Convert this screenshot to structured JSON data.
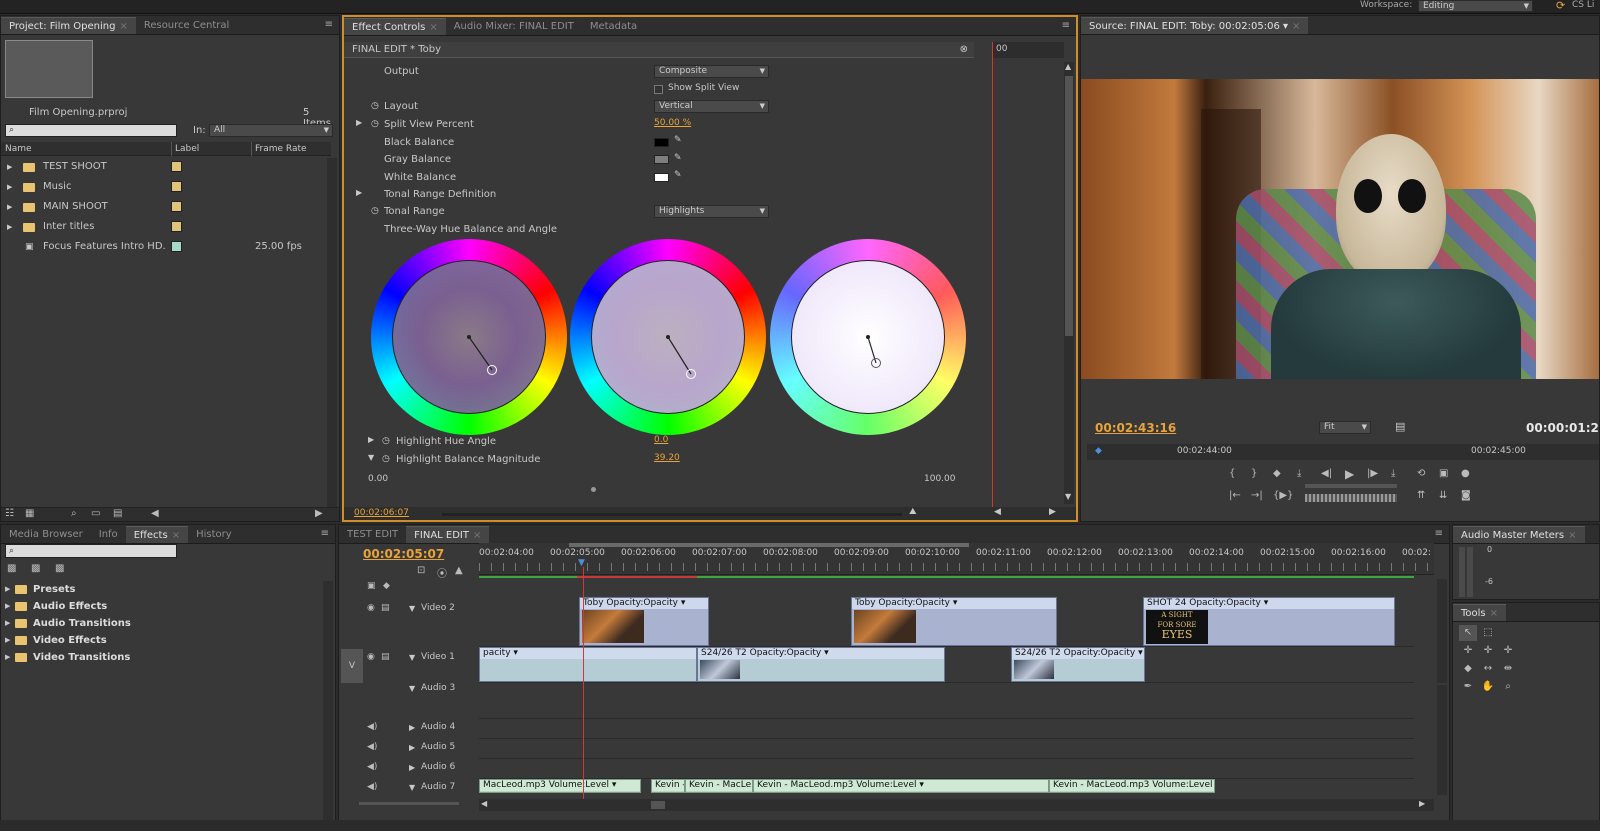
{
  "topbar": {
    "workspace_label": "Workspace:",
    "workspace_value": "Editing",
    "right_label": "CS Li"
  },
  "project_panel": {
    "tabs": [
      "Project: Film Opening",
      "Resource Central"
    ],
    "project_file": "Film Opening.prproj",
    "item_count": "5 Items",
    "in_label": "In:",
    "in_value": "All",
    "columns": [
      "Name",
      "Label",
      "Frame Rate"
    ],
    "items": [
      {
        "name": "TEST SHOOT",
        "label_color": "#e0c47a",
        "frame_rate": ""
      },
      {
        "name": "Music",
        "label_color": "#e0c47a",
        "frame_rate": ""
      },
      {
        "name": "MAIN SHOOT",
        "label_color": "#e0c47a",
        "frame_rate": ""
      },
      {
        "name": "Inter titles",
        "label_color": "#e0c47a",
        "frame_rate": ""
      },
      {
        "name": "Focus Features Intro HD.",
        "label_color": "#a8d8c8",
        "frame_rate": "25.00 fps"
      }
    ]
  },
  "effect_controls": {
    "tabs": [
      "Effect Controls",
      "Audio Mixer: FINAL EDIT",
      "Metadata"
    ],
    "clip_title": "FINAL EDIT * Toby",
    "mini_time": "00",
    "params": {
      "output_label": "Output",
      "output_value": "Composite",
      "show_split_view": "Show Split View",
      "layout_label": "Layout",
      "layout_value": "Vertical",
      "split_label": "Split View Percent",
      "split_value": "50.00 %",
      "black_balance": "Black Balance",
      "gray_balance": "Gray Balance",
      "white_balance": "White Balance",
      "tonal_def": "Tonal Range Definition",
      "tonal_label": "Tonal Range",
      "tonal_value": "Highlights",
      "three_way": "Three-Way Hue Balance and Angle",
      "hue_angle_label": "Highlight Hue Angle",
      "hue_angle_value": "0.0",
      "magnitude_label": "Highlight Balance Magnitude",
      "magnitude_value": "39.20",
      "slider_min": "0.00",
      "slider_max": "100.00"
    },
    "timecode": "00:02:06:07"
  },
  "source_monitor": {
    "tab": "Source: FINAL EDIT: Toby: 00:02:05:06",
    "timecode_left": "00:02:43:16",
    "fit_value": "Fit",
    "timecode_right": "00:00:01:2",
    "ruler": [
      "00:02:44:00",
      "00:02:45:00"
    ]
  },
  "effects_panel": {
    "tabs": [
      "Media Browser",
      "Info",
      "Effects",
      "History"
    ],
    "folders": [
      "Presets",
      "Audio Effects",
      "Audio Transitions",
      "Video Effects",
      "Video Transitions"
    ]
  },
  "timeline": {
    "tabs": [
      "TEST EDIT",
      "FINAL EDIT"
    ],
    "timecode": "00:02:05:07",
    "ruler": [
      "00:02:04:00",
      "00:02:05:00",
      "00:02:06:00",
      "00:02:07:00",
      "00:02:08:00",
      "00:02:09:00",
      "00:02:10:00",
      "00:02:11:00",
      "00:02:12:00",
      "00:02:13:00",
      "00:02:14:00",
      "00:02:15:00",
      "00:02:16:00",
      "00:02:"
    ],
    "tracks": {
      "video2": "Video 2",
      "video1": "Video 1",
      "audio3": "Audio 3",
      "audio4": "Audio 4",
      "audio5": "Audio 5",
      "audio6": "Audio 6",
      "audio7": "Audio 7"
    },
    "video2_clips": [
      {
        "name": "Toby",
        "fx": "Opacity:Opacity"
      },
      {
        "name": "Toby",
        "fx": "Opacity:Opacity"
      },
      {
        "name": "SHOT 24",
        "fx": "Opacity:Opacity"
      }
    ],
    "video1_clips": [
      {
        "name": "",
        "fx": "pacity"
      },
      {
        "name": "S24/26 T2",
        "fx": "Opacity:Opacity"
      },
      {
        "name": "S24/26 T2",
        "fx": "Opacity:Opacity"
      }
    ],
    "audio7_clips": [
      {
        "name": "MacLeod.mp3",
        "fx": "Volume:Level"
      },
      {
        "name": "Kevin -",
        "fx": ""
      },
      {
        "name": "Kevin - MacLe",
        "fx": ""
      },
      {
        "name": "Kevin - MacLeod.mp3",
        "fx": "Volume:Level"
      },
      {
        "name": "Kevin - MacLeod.mp3",
        "fx": "Volume:Level"
      }
    ],
    "title_card_text": [
      "A SIGHT",
      "FOR SORE",
      "EYES"
    ],
    "v_label": "V"
  },
  "audio_meters": {
    "tab": "Audio Master Meters",
    "scale": [
      "0",
      "-6"
    ]
  },
  "tools": {
    "tab": "Tools"
  }
}
